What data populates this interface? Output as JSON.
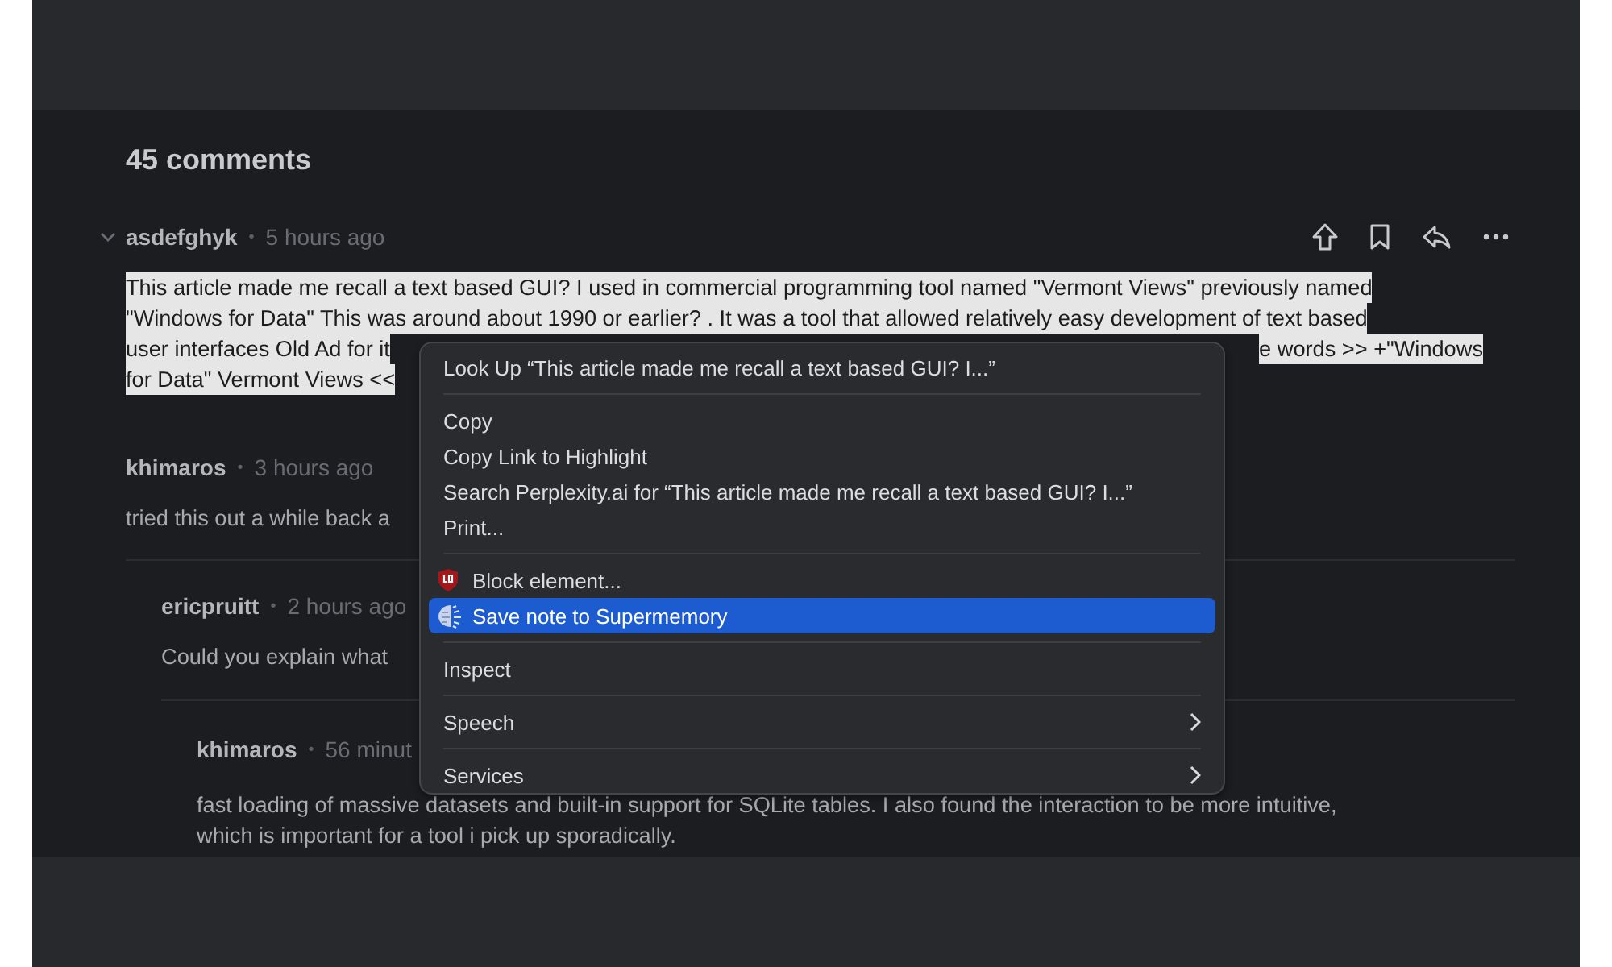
{
  "comments_heading": "45 comments",
  "comments": [
    {
      "author": "asdefghyk",
      "separator": "•",
      "time": "5 hours ago",
      "hovered": true,
      "highlighted": true,
      "lines": [
        {
          "left": "This article made me recall a text based GUI? I used in commercial programming tool named \"Vermont Views\" previously named"
        },
        {
          "left": "\"Windows for Data\" This was around about 1990 or earlier? . It was a tool that allowed relatively easy development of text based"
        },
        {
          "left": "user interfaces Old Ad for it",
          "right": "e words >> +\"Windows"
        },
        {
          "left": "for Data\" Vermont Views <<"
        }
      ]
    },
    {
      "author": "khimaros",
      "separator": "•",
      "time": "3 hours ago",
      "hovered": false,
      "highlighted": false,
      "lines": [
        {
          "left": "tried this out a while back a"
        }
      ],
      "children": [
        {
          "author": "ericpruitt",
          "separator": "•",
          "time": "2 hours ago",
          "hovered": false,
          "highlighted": false,
          "lines": [
            {
              "left": "Could you explain what"
            }
          ],
          "children": [
            {
              "author": "khimaros",
              "separator": "•",
              "time": "56 minut",
              "hovered": false,
              "highlighted": false,
              "lines": [
                {
                  "left": "fast loading of massive datasets and built-in support for SQLite tables. I also found the interaction to be more intuitive,"
                },
                {
                  "left": "which is important for a tool i pick up sporadically."
                }
              ]
            }
          ]
        }
      ]
    }
  ],
  "context_menu": {
    "items": [
      {
        "kind": "item",
        "label": "Look Up “This article made me recall a text based GUI? I...”",
        "selected": false
      },
      {
        "kind": "separator"
      },
      {
        "kind": "item",
        "label": "Copy",
        "selected": false
      },
      {
        "kind": "item",
        "label": "Copy Link to Highlight",
        "selected": false
      },
      {
        "kind": "item",
        "label": "Search Perplexity.ai for “This article made me recall a text based GUI? I...”",
        "selected": false
      },
      {
        "kind": "item",
        "label": "Print...",
        "selected": false
      },
      {
        "kind": "separator"
      },
      {
        "kind": "icon_item",
        "label": "Block element...",
        "selected": false
      },
      {
        "kind": "icon_item",
        "label": "Save note to Supermemory",
        "selected": true
      },
      {
        "kind": "separator"
      },
      {
        "kind": "item",
        "label": "Inspect",
        "selected": false
      },
      {
        "kind": "separator"
      },
      {
        "kind": "submenu",
        "label": "Speech",
        "selected": false
      },
      {
        "kind": "separator"
      },
      {
        "kind": "submenu",
        "label": "Services",
        "selected": false
      }
    ]
  }
}
